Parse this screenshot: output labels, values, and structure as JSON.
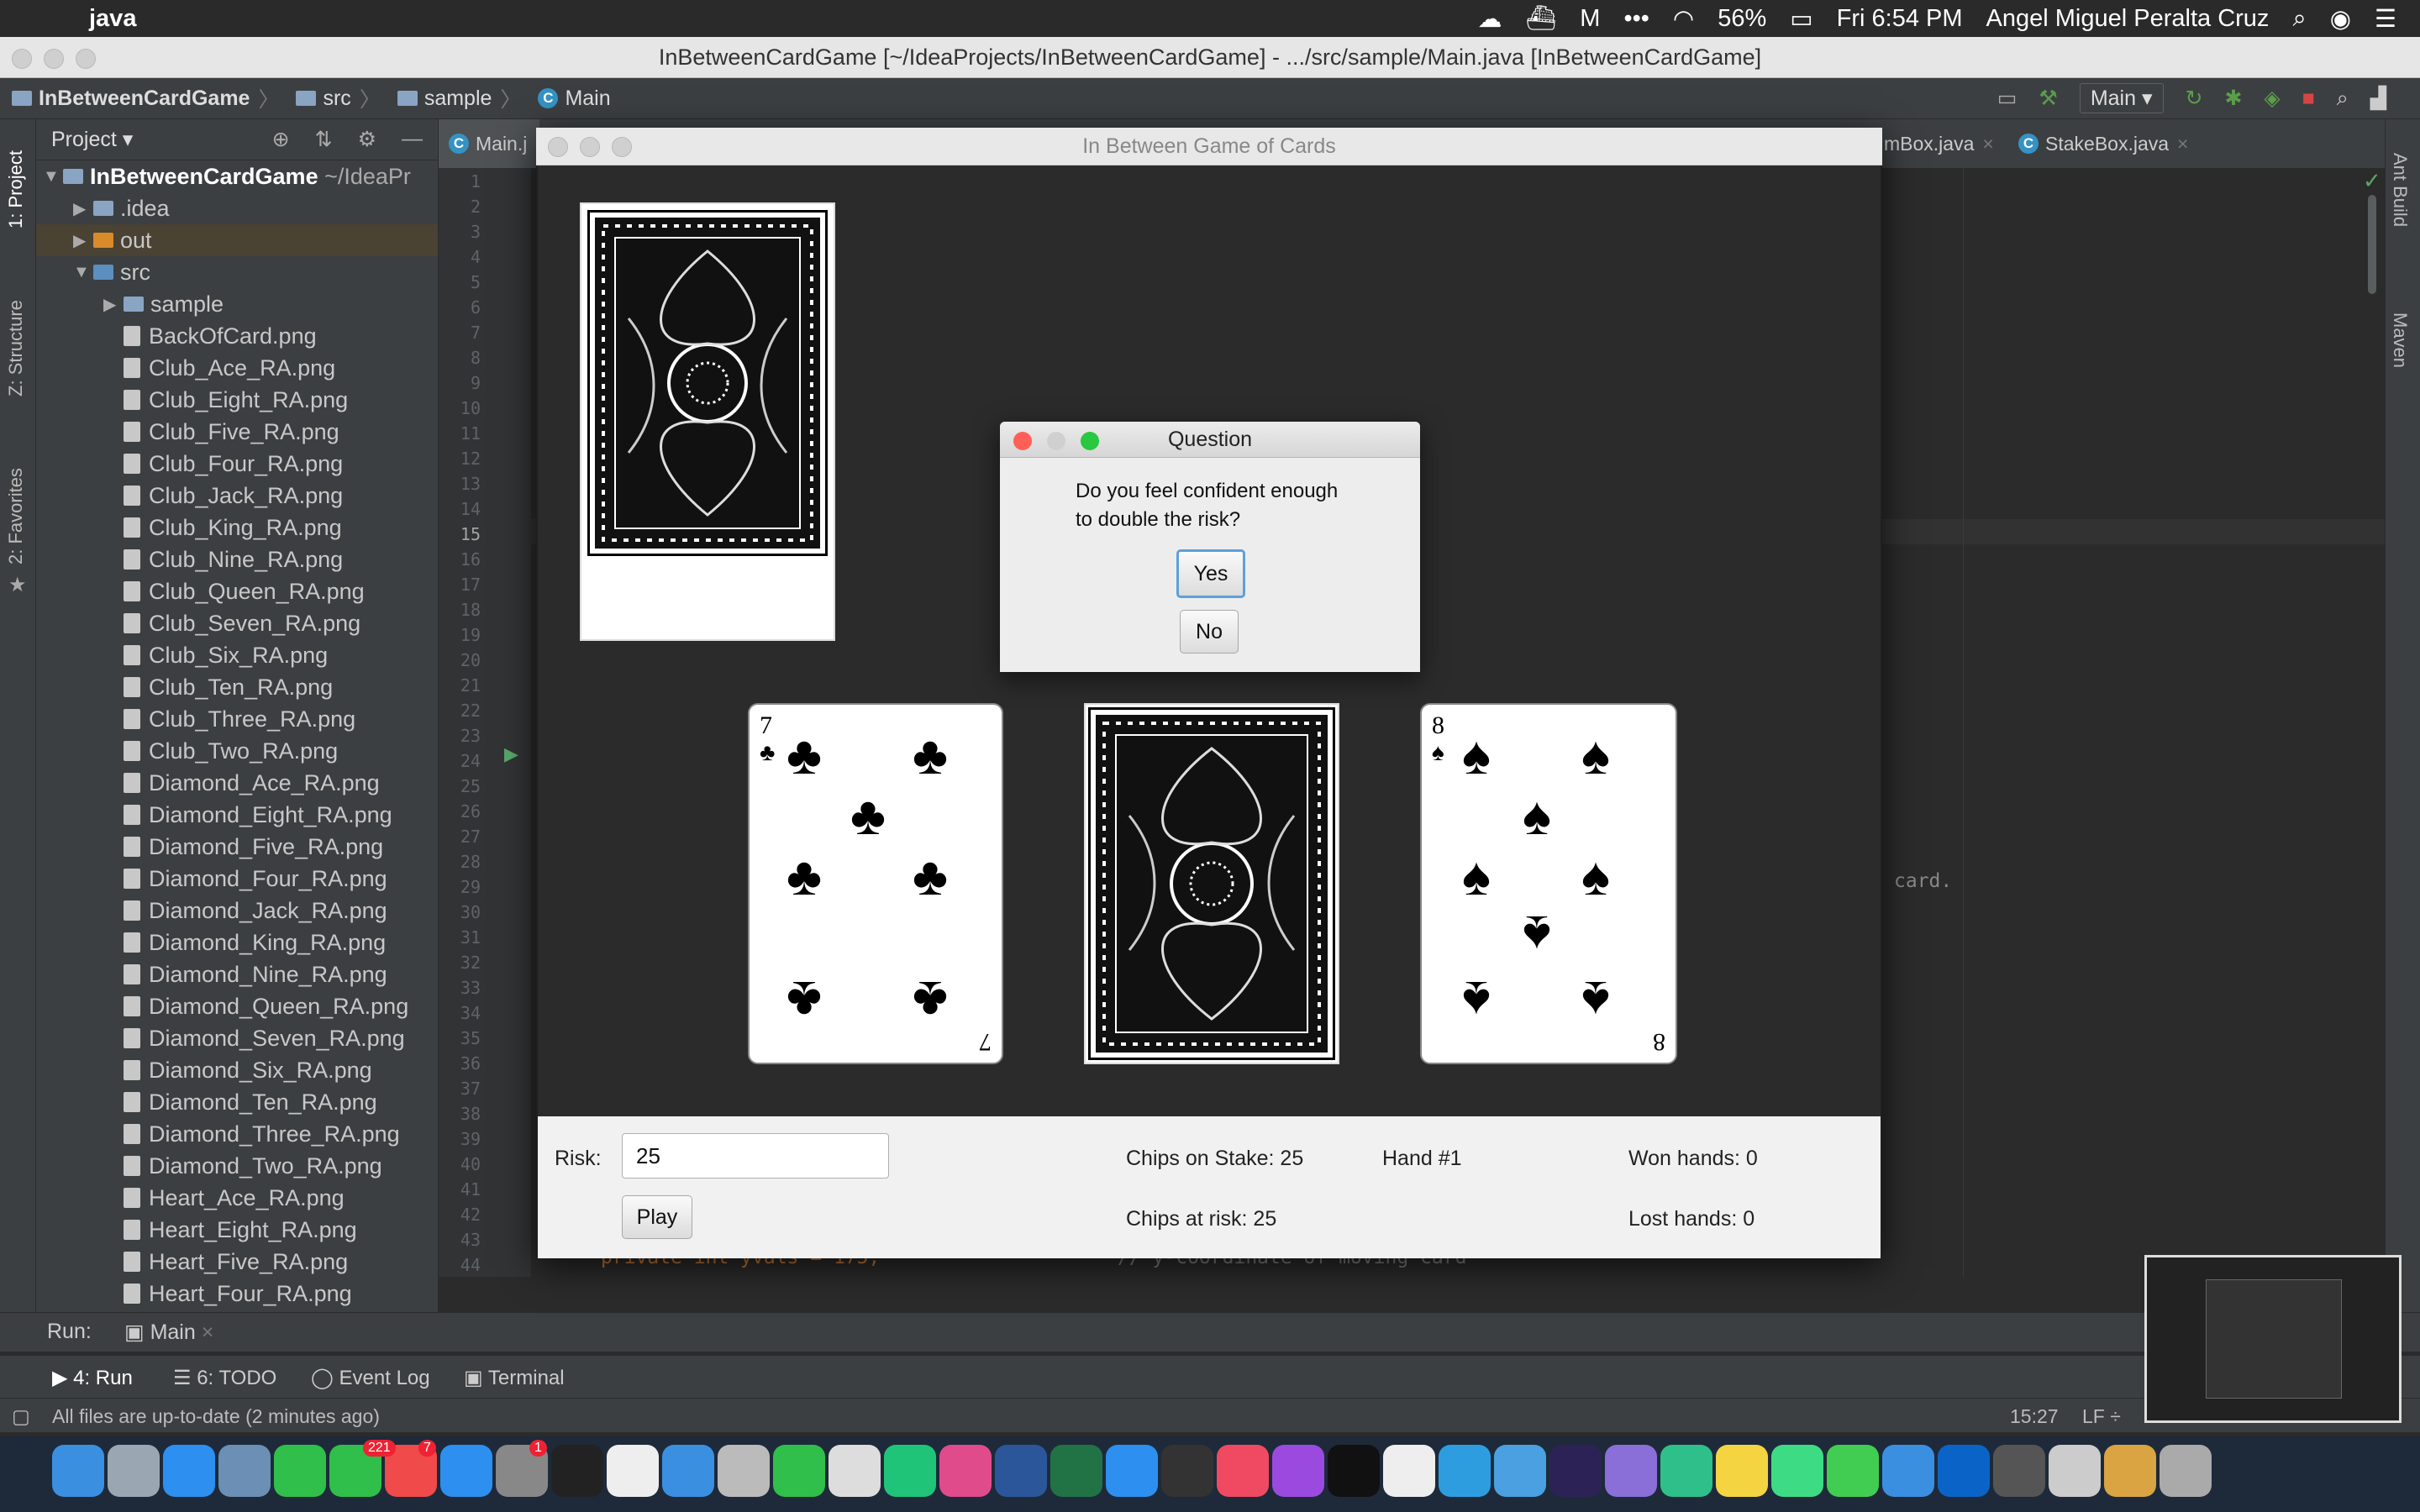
{
  "menubar": {
    "apple": "",
    "app": "java",
    "battery": "56%",
    "clock": "Fri 6:54 PM",
    "user": "Angel Miguel Peralta Cruz"
  },
  "window": {
    "title": "InBetweenCardGame [~/IdeaProjects/InBetweenCardGame] - .../src/sample/Main.java [InBetweenCardGame]"
  },
  "navbar": {
    "crumbs": [
      "InBetweenCardGame",
      "src",
      "sample",
      "Main"
    ],
    "run_config": "Main"
  },
  "left_strip": {
    "tab1": "1: Project",
    "tab2": "Z: Structure",
    "tab3": "2: Favorites"
  },
  "project": {
    "header": "Project",
    "root": "InBetweenCardGame",
    "root_path": "~/IdeaPr",
    "tree": [
      {
        "label": ".idea",
        "indent": 1,
        "kind": "folder",
        "arrow": "▶"
      },
      {
        "label": "out",
        "indent": 1,
        "kind": "folder-orange",
        "arrow": "▶"
      },
      {
        "label": "src",
        "indent": 1,
        "kind": "folder",
        "arrow": "▼"
      },
      {
        "label": "sample",
        "indent": 2,
        "kind": "folder",
        "arrow": "▶"
      },
      {
        "label": "BackOfCard.png",
        "indent": 2,
        "kind": "file",
        "arrow": ""
      },
      {
        "label": "Club_Ace_RA.png",
        "indent": 2,
        "kind": "file",
        "arrow": ""
      },
      {
        "label": "Club_Eight_RA.png",
        "indent": 2,
        "kind": "file",
        "arrow": ""
      },
      {
        "label": "Club_Five_RA.png",
        "indent": 2,
        "kind": "file",
        "arrow": ""
      },
      {
        "label": "Club_Four_RA.png",
        "indent": 2,
        "kind": "file",
        "arrow": ""
      },
      {
        "label": "Club_Jack_RA.png",
        "indent": 2,
        "kind": "file",
        "arrow": ""
      },
      {
        "label": "Club_King_RA.png",
        "indent": 2,
        "kind": "file",
        "arrow": ""
      },
      {
        "label": "Club_Nine_RA.png",
        "indent": 2,
        "kind": "file",
        "arrow": ""
      },
      {
        "label": "Club_Queen_RA.png",
        "indent": 2,
        "kind": "file",
        "arrow": ""
      },
      {
        "label": "Club_Seven_RA.png",
        "indent": 2,
        "kind": "file",
        "arrow": ""
      },
      {
        "label": "Club_Six_RA.png",
        "indent": 2,
        "kind": "file",
        "arrow": ""
      },
      {
        "label": "Club_Ten_RA.png",
        "indent": 2,
        "kind": "file",
        "arrow": ""
      },
      {
        "label": "Club_Three_RA.png",
        "indent": 2,
        "kind": "file",
        "arrow": ""
      },
      {
        "label": "Club_Two_RA.png",
        "indent": 2,
        "kind": "file",
        "arrow": ""
      },
      {
        "label": "Diamond_Ace_RA.png",
        "indent": 2,
        "kind": "file",
        "arrow": ""
      },
      {
        "label": "Diamond_Eight_RA.png",
        "indent": 2,
        "kind": "file",
        "arrow": ""
      },
      {
        "label": "Diamond_Five_RA.png",
        "indent": 2,
        "kind": "file",
        "arrow": ""
      },
      {
        "label": "Diamond_Four_RA.png",
        "indent": 2,
        "kind": "file",
        "arrow": ""
      },
      {
        "label": "Diamond_Jack_RA.png",
        "indent": 2,
        "kind": "file",
        "arrow": ""
      },
      {
        "label": "Diamond_King_RA.png",
        "indent": 2,
        "kind": "file",
        "arrow": ""
      },
      {
        "label": "Diamond_Nine_RA.png",
        "indent": 2,
        "kind": "file",
        "arrow": ""
      },
      {
        "label": "Diamond_Queen_RA.png",
        "indent": 2,
        "kind": "file",
        "arrow": ""
      },
      {
        "label": "Diamond_Seven_RA.png",
        "indent": 2,
        "kind": "file",
        "arrow": ""
      },
      {
        "label": "Diamond_Six_RA.png",
        "indent": 2,
        "kind": "file",
        "arrow": ""
      },
      {
        "label": "Diamond_Ten_RA.png",
        "indent": 2,
        "kind": "file",
        "arrow": ""
      },
      {
        "label": "Diamond_Three_RA.png",
        "indent": 2,
        "kind": "file",
        "arrow": ""
      },
      {
        "label": "Diamond_Two_RA.png",
        "indent": 2,
        "kind": "file",
        "arrow": ""
      },
      {
        "label": "Heart_Ace_RA.png",
        "indent": 2,
        "kind": "file",
        "arrow": ""
      },
      {
        "label": "Heart_Eight_RA.png",
        "indent": 2,
        "kind": "file",
        "arrow": ""
      },
      {
        "label": "Heart_Five_RA.png",
        "indent": 2,
        "kind": "file",
        "arrow": ""
      },
      {
        "label": "Heart_Four_RA.png",
        "indent": 2,
        "kind": "file",
        "arrow": ""
      }
    ]
  },
  "editor": {
    "tabs": [
      "Main.j",
      "mBox.java",
      "StakeBox.java"
    ],
    "line_numbers_from": 1,
    "line_numbers_to": 44,
    "current_line": 15,
    "visible_code_fragments": [
      "card.",
      "private int yvals = 175;",
      "// y-coordinate of moving card"
    ]
  },
  "right_strip": {
    "tab1": "Ant Build",
    "tab2": "Maven"
  },
  "app": {
    "title": "In Between Game of Cards",
    "risk_label": "Risk:",
    "risk_value": "25",
    "play_label": "Play",
    "chips_on_stake": "Chips on Stake: 25",
    "chips_at_risk": "Chips at risk: 25",
    "hand": "Hand #1",
    "won_hands": "Won hands: 0",
    "lost_hands": "Lost hands: 0",
    "cards": [
      {
        "rank": "7",
        "suit": "♣",
        "face": "up"
      },
      {
        "rank": "",
        "suit": "",
        "face": "down"
      },
      {
        "rank": "8",
        "suit": "♠",
        "face": "up"
      }
    ]
  },
  "dialog": {
    "title": "Question",
    "message_line1": "Do you feel confident enough",
    "message_line2": "to double the risk?",
    "yes_label": "Yes",
    "no_label": "No"
  },
  "runbar": {
    "label": "Run:",
    "config": "Main"
  },
  "bottom_tools": {
    "run": "4: Run",
    "todo": "6: TODO",
    "event_log": "Event Log",
    "terminal": "Terminal"
  },
  "statusbar": {
    "message": "All files are up-to-date (2 minutes ago)",
    "position": "15:27",
    "line_sep": "LF ÷"
  },
  "dock_badges": {
    "mail": "221",
    "facetime": "7",
    "appstore": "1"
  },
  "colors": {
    "accent": "#3592c4",
    "editor_bg": "#2b2b2b",
    "panel_bg": "#3c3f41",
    "close_red": "#ff5f57",
    "min_yellow": "#febc2e",
    "max_green": "#28c840"
  }
}
